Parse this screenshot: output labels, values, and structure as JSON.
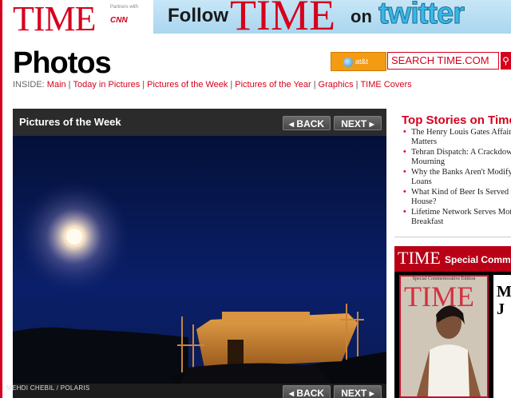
{
  "header": {
    "logo": "TIME",
    "partners": "Partners with",
    "partner_logo": "CNN",
    "banner": {
      "follow": "Follow",
      "time": "TIME",
      "on": "on",
      "twitter": "twitter"
    }
  },
  "page_title": "Photos",
  "search": {
    "att_label": "at&t",
    "placeholder": "SEARCH TIME.COM"
  },
  "nav": {
    "label": "INSIDE:",
    "links": [
      "Main",
      "Today in Pictures",
      "Pictures of the Week",
      "Pictures of the Year",
      "Graphics",
      "TIME Covers"
    ]
  },
  "gallery": {
    "title": "Pictures of the Week",
    "back": "BACK",
    "next": "NEXT",
    "credit": "MEHDI CHEBIL / POLARIS"
  },
  "sidebar": {
    "title": "Top Stories on Time",
    "stories": [
      [
        "The Henry Louis Gates Affair",
        "Matters"
      ],
      [
        "Tehran Dispatch: A Crackdown",
        "Mourning"
      ],
      [
        "Why the Banks Aren't Modifying",
        "Loans"
      ],
      [
        "What Kind of Beer Is Served",
        "House?"
      ],
      [
        "Lifetime Network Serves Mothers",
        "Breakfast"
      ]
    ],
    "promo_time": "TIME",
    "promo_label": "Special Commemorative",
    "cover_edition": "Special Commemorative Edition",
    "cover_title": "TIME",
    "side_letters": [
      "M",
      "J"
    ]
  },
  "colors": {
    "brand_red": "#d6001c",
    "att_orange": "#f39b13"
  }
}
